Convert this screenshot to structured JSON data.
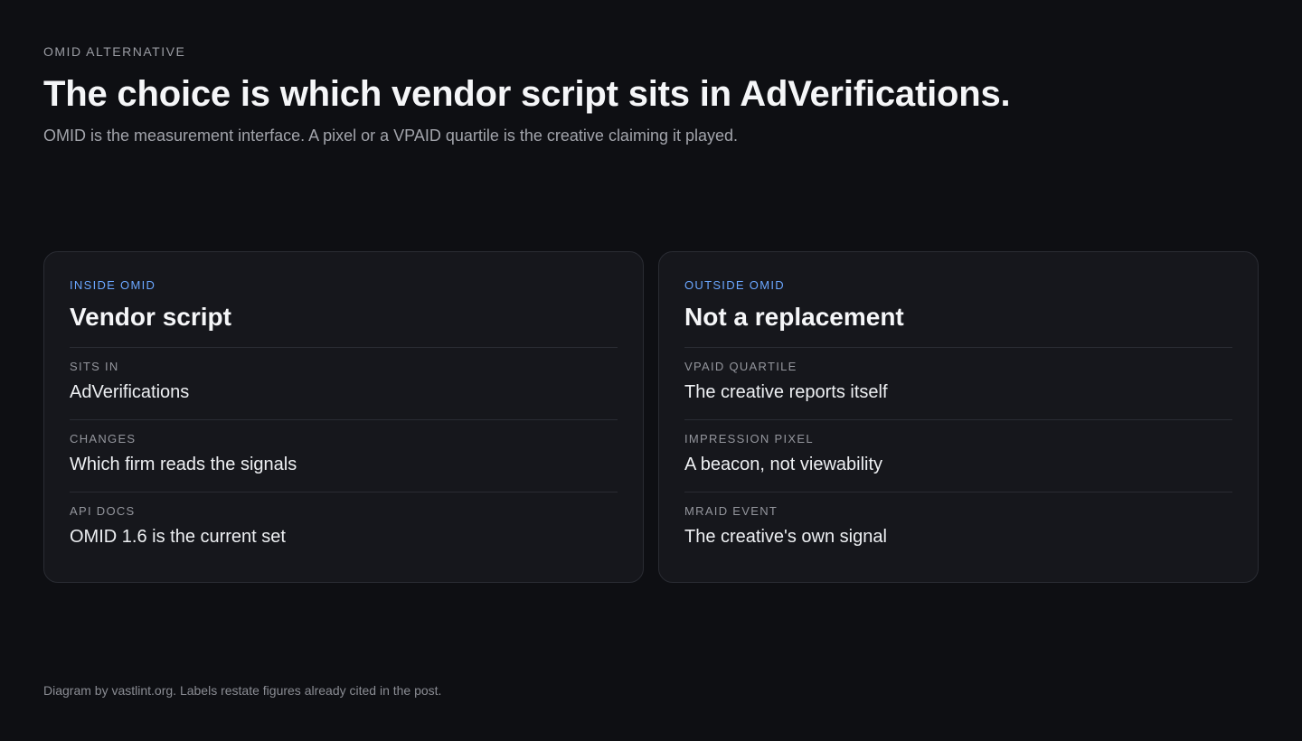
{
  "header": {
    "eyebrow": "OMID ALTERNATIVE",
    "title": "The choice is which vendor script sits in AdVerifications.",
    "subtitle": "OMID is the measurement interface. A pixel or a VPAID quartile is the creative claiming it played."
  },
  "cards": [
    {
      "eyebrow": "INSIDE OMID",
      "title": "Vendor script",
      "rows": [
        {
          "label": "SITS IN",
          "value": "AdVerifications"
        },
        {
          "label": "CHANGES",
          "value": "Which firm reads the signals"
        },
        {
          "label": "API DOCS",
          "value": "OMID 1.6 is the current set"
        }
      ]
    },
    {
      "eyebrow": "OUTSIDE OMID",
      "title": "Not a replacement",
      "rows": [
        {
          "label": "VPAID QUARTILE",
          "value": "The creative reports itself"
        },
        {
          "label": "IMPRESSION PIXEL",
          "value": "A beacon, not viewability"
        },
        {
          "label": "MRAID EVENT",
          "value": "The creative's own signal"
        }
      ]
    }
  ],
  "footer": {
    "text": "Diagram by vastlint.org. Labels restate figures already cited in the post."
  },
  "colors": {
    "background": "#0e0f13",
    "card": "#16171c",
    "accent": "#6aa6ff",
    "border": "#2a2c33"
  }
}
